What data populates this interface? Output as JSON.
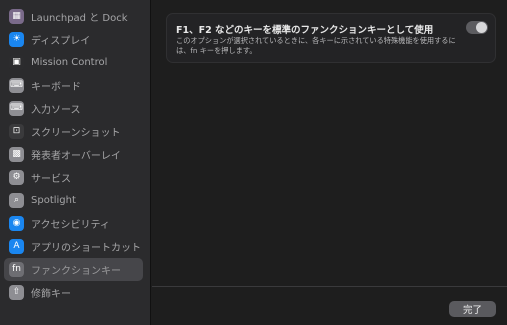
{
  "sidebar": {
    "items": [
      {
        "label": "Launchpad と Dock",
        "icon": "launchpad-dock-icon",
        "glyph": "▦",
        "color": "#7a6a8a"
      },
      {
        "label": "ディスプレイ",
        "icon": "display-icon",
        "glyph": "☀",
        "color": "#1a86f0"
      },
      {
        "label": "Mission Control",
        "icon": "mission-control-icon",
        "glyph": "▣",
        "color": "#2c2c2e"
      },
      {
        "label": "キーボード",
        "icon": "keyboard-icon",
        "glyph": "⌨",
        "color": "#8e8e93"
      },
      {
        "label": "入力ソース",
        "icon": "input-sources-icon",
        "glyph": "⌨",
        "color": "#8e8e93"
      },
      {
        "label": "スクリーンショット",
        "icon": "screenshot-icon",
        "glyph": "⊡",
        "color": "#3a3a3c"
      },
      {
        "label": "発表者オーバーレイ",
        "icon": "presenter-overlay-icon",
        "glyph": "▩",
        "color": "#8e8e93"
      },
      {
        "label": "サービス",
        "icon": "services-icon",
        "glyph": "⚙",
        "color": "#8e8e93"
      },
      {
        "label": "Spotlight",
        "icon": "spotlight-icon",
        "glyph": "⌕",
        "color": "#8e8e93"
      },
      {
        "label": "アクセシビリティ",
        "icon": "accessibility-icon",
        "glyph": "◉",
        "color": "#1a86f0"
      },
      {
        "label": "アプリのショートカット",
        "icon": "app-shortcuts-icon",
        "glyph": "A",
        "color": "#1a86f0"
      },
      {
        "label": "ファンクションキー",
        "icon": "function-keys-icon",
        "glyph": "fn",
        "color": "#6e6e73",
        "selected": true
      },
      {
        "label": "修飾キー",
        "icon": "modifier-keys-icon",
        "glyph": "⇧",
        "color": "#8e8e93"
      }
    ]
  },
  "main": {
    "setting": {
      "title": "F1、F2 などのキーを標準のファンクションキーとして使用",
      "description": "このオプションが選択されているときに、各キーに示されている特殊機能を使用するには、fn キーを押します。",
      "enabled": true
    },
    "done_label": "完了"
  }
}
